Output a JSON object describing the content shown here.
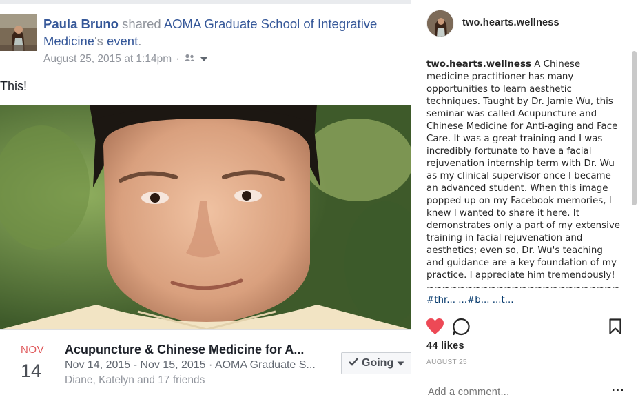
{
  "facebook": {
    "header": {
      "sharer_name": "Paula Bruno",
      "shared_text": "shared",
      "page_name": "AOMA Graduate School of Integrative Medicine",
      "possessive": "'s",
      "event_link": "event",
      "period": "."
    },
    "meta": {
      "timestamp": "August 25, 2015 at 1:14pm",
      "separator": "·",
      "audience_icon": "friends-icon",
      "menu_icon": "caret-down-icon"
    },
    "post_text": "This!",
    "event": {
      "month": "NOV",
      "day": "14",
      "title": "Acupuncture & Chinese Medicine for A...",
      "dates": "Nov 14, 2015 - Nov 15, 2015 · AOMA Graduate S...",
      "friends": "Diane, Katelyn and 17 friends",
      "going_label": "Going"
    }
  },
  "instagram": {
    "username": "two.hearts.wellness",
    "caption_username": "two.hearts.wellness",
    "caption": "A Chinese medicine practitioner has many opportunities to learn aesthetic techniques. Taught by Dr. Jamie Wu, this seminar was called Acupuncture and Chinese Medicine for Anti-aging and Face Care. It was a great training and I was incredibly fortunate to have a facial rejuvenation internship term with Dr. Wu as my clinical supervisor once I became an advanced student. When this image popped up on my Facebook memories, I knew I wanted to share it here. It demonstrates only a part of my extensive training in facial rejuvenation and aesthetics; even so, Dr. Wu's teaching and guidance are a key foundation of my practice. I appreciate him tremendously!",
    "divider": "~~~~~~~~~~~~~~~~~~~~~~~~~",
    "hashtags": "#thr... ...#b... ...t...",
    "likes": "44 likes",
    "date": "AUGUST 25",
    "comment_placeholder": "Add a comment...",
    "more": "···",
    "colors": {
      "heart": "#ed4956",
      "text": "#262626",
      "muted": "#999999"
    },
    "icons": [
      "heart-icon",
      "comment-icon",
      "bookmark-icon"
    ]
  }
}
